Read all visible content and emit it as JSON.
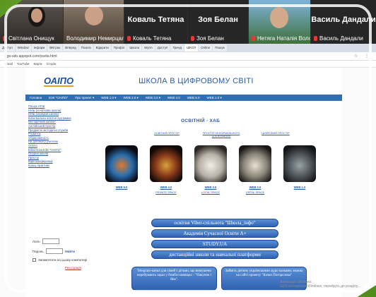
{
  "participants": [
    {
      "name": "Світлана Онищук",
      "kind": "video"
    },
    {
      "name": "Володимир Немирцалов",
      "kind": "video"
    },
    {
      "name": "Коваль Тетяна",
      "kind": "name"
    },
    {
      "name": "Зоя Белан",
      "kind": "name"
    },
    {
      "name": "Нетяга Наталія Волод...",
      "kind": "video"
    },
    {
      "name": "Василь Дандали",
      "kind": "name"
    }
  ],
  "browser": {
    "tabs": [
      "Доступ",
      "Window",
      "Інформ",
      "ВМ раз",
      "Вперед",
      "Пошта",
      "Відкрити",
      "Профіл",
      "Школа",
      "Wyrm",
      "Доступ",
      "Тренд",
      "ШКОЛ",
      "Online",
      "Пошук"
    ],
    "active_tab_index": 12,
    "url": "ipgo-sdo.appspot.com/osvita.html",
    "bookmarks": [
      "Gmail",
      "YouTube",
      "Карти",
      "Сторін"
    ]
  },
  "site": {
    "logo": "ОАІПО",
    "title": "ШКОЛА В ЦИФРОВОМУ СВІТІ",
    "menu": [
      "Головна",
      "ЕЗК \"ОАІПО\"",
      "Про проект ▾",
      "WEB 1.0 ▾",
      "WEB 2.0 ▾",
      "WEB 3.0 ▾",
      "WEB 4.0",
      "WEB 5.0",
      "WEB 1.0 ▾"
    ],
    "sidebar": [
      "Пошук НУШ",
      "НУШ (початкова школа)",
      "НУШ (середня школа)",
      "Білінгвальна освітня підтримка",
      "Методичний кабінет",
      "Англійський простір",
      "Предметні методичні служби",
      "Розвиток",
      "Обдарованість",
      "На допомогу учителю",
      "Освіта",
      "Бібліотека ЕЗК \"ОАІПО\"",
      "Опорна школа",
      "Простір",
      "Відеоконференції",
      "Кращі практики"
    ],
    "login": {
      "login_label": "Логін",
      "password_label": "Пароль",
      "enter": "Увійти",
      "remember": "Запам'ятати на цьому комп'ютері",
      "register": "Реєстрація"
    },
    "hub_title": "ОСВІТНІЙ - ХАБ",
    "hub_links": [
      "ОСВІТНІЙ ПРОСТІР",
      "ПРОСТІР НЕФОРМАЛЬНОГО СПІЛКУВАННЯ",
      "ЦИФРОВИЙ ПРОСТІР"
    ],
    "web_items": [
      {
        "label": "WEB 5.0",
        "sub": ""
      },
      {
        "label": "WEB 4.0",
        "sub": "PRIVATE SPACE"
      },
      {
        "label": "WEB 3.0",
        "sub": "LOCAL SPACE"
      },
      {
        "label": "WEB 2.0",
        "sub": "OPENL SPACE"
      },
      {
        "label": "WEB 1.0",
        "sub": ""
      }
    ],
    "pills": [
      "освітня Viber-спільнота \"Школа_інфо\"",
      "Академія Сучасної Освіти А+",
      "STUDY.UA",
      "дистанційні школи та навчальні платформи"
    ],
    "boxes": [
      "Telegram-канал для сімей з дітьми, що вимушено перебувають зараз у бомбосховищах - \"Пакунок і Ява\".",
      "Займіть дитину українськими аудіо казками, можна на сайті проекту \"Казки Погорєлова\""
    ],
    "activation": "Активація Windows\nЩоб активувати Windows, перейдіть до розділу..."
  },
  "colors": {
    "accent": "#2f6fb3",
    "frame": "#6fae2f"
  }
}
